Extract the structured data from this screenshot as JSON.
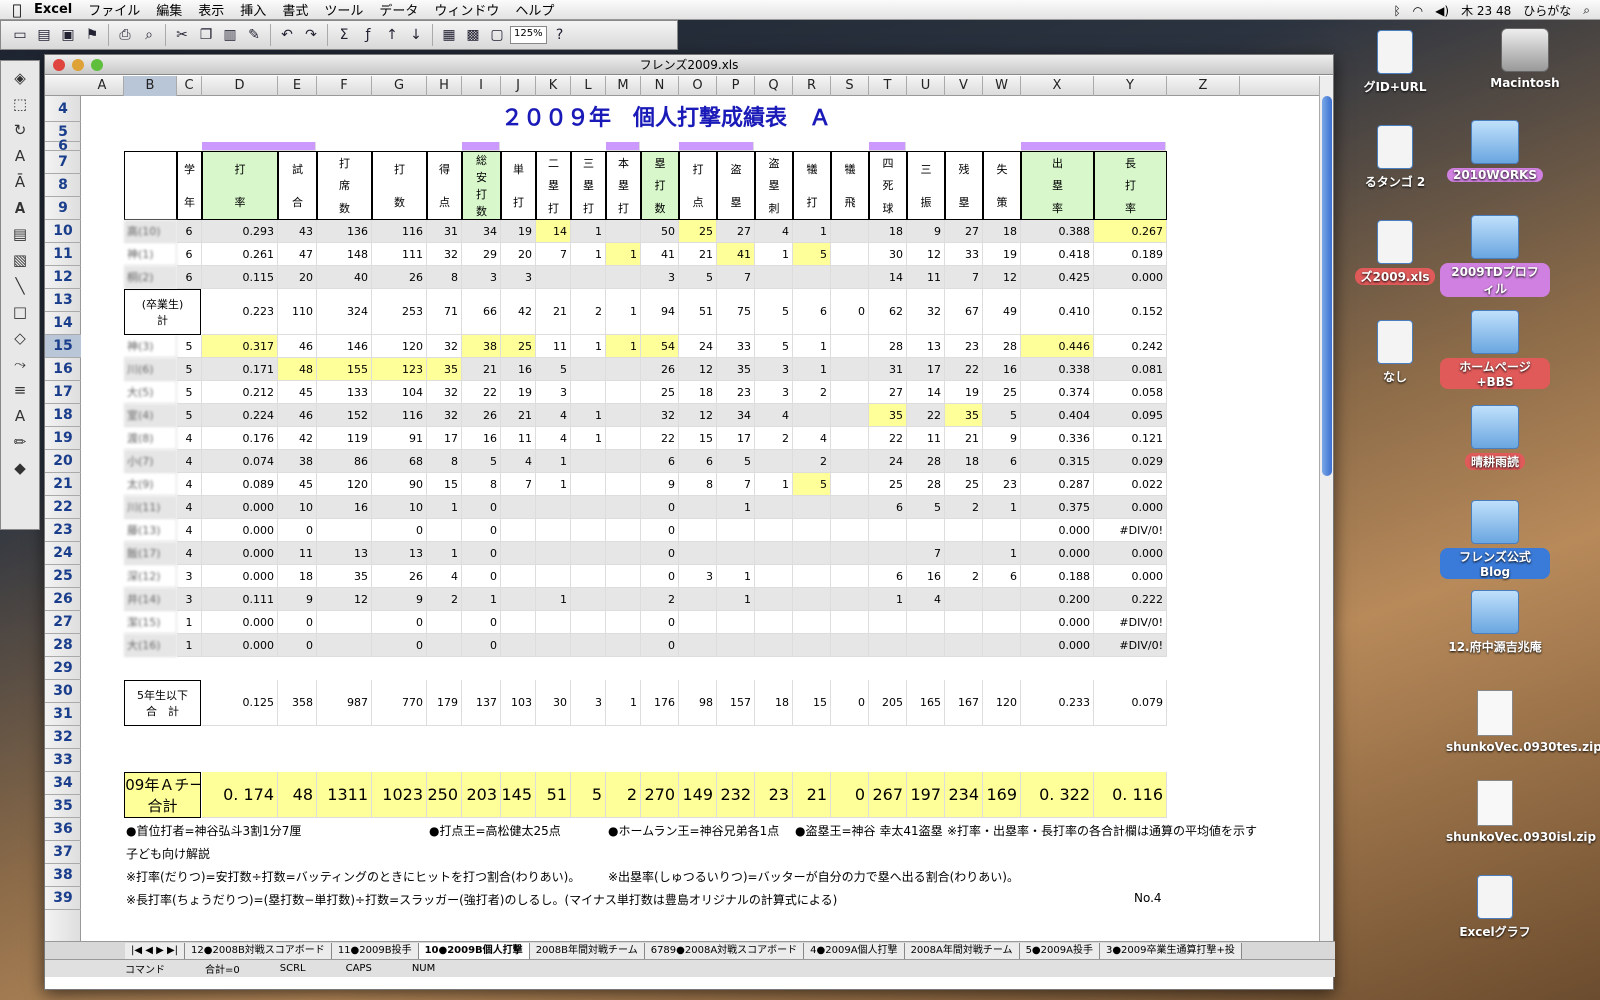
{
  "menubar": {
    "app": "Excel",
    "items": [
      "ファイル",
      "編集",
      "表示",
      "挿入",
      "書式",
      "ツール",
      "データ",
      "ウィンドウ",
      "ヘルプ"
    ],
    "clock": "木 23 48",
    "input": "ひらがな"
  },
  "toolbar": {
    "zoom": "125%"
  },
  "window": {
    "title": "フレンズ2009.xls"
  },
  "columns": [
    "A",
    "B",
    "C",
    "D",
    "E",
    "F",
    "G",
    "H",
    "I",
    "J",
    "K",
    "L",
    "M",
    "N",
    "O",
    "P",
    "Q",
    "R",
    "S",
    "T",
    "U",
    "V",
    "W",
    "X",
    "Y",
    "Z"
  ],
  "sheet": {
    "title": "２００９年　個人打撃成績表　Ａ",
    "headers": {
      "C": [
        "学",
        "年"
      ],
      "D": [
        "打",
        "率"
      ],
      "E": [
        "試",
        "合"
      ],
      "F": [
        "打",
        "席",
        "数"
      ],
      "G": [
        "打",
        "数"
      ],
      "H": [
        "得",
        "点"
      ],
      "I": [
        "総",
        "安",
        "打",
        "数"
      ],
      "J": [
        "単",
        "打"
      ],
      "K": [
        "二",
        "塁",
        "打"
      ],
      "L": [
        "三",
        "塁",
        "打"
      ],
      "M": [
        "本",
        "塁",
        "打"
      ],
      "N": [
        "塁",
        "打",
        "数"
      ],
      "O": [
        "打",
        "点"
      ],
      "P": [
        "盗",
        "塁"
      ],
      "Q": [
        "盗",
        "塁",
        "刺"
      ],
      "R": [
        "犠",
        "打"
      ],
      "S": [
        "犠",
        "飛"
      ],
      "T": [
        "四",
        "死",
        "球"
      ],
      "U": [
        "三",
        "振"
      ],
      "V": [
        "残",
        "塁"
      ],
      "W": [
        "失",
        "策"
      ],
      "X": [
        "出",
        "塁",
        "率"
      ],
      "Y": [
        "長",
        "打",
        "率"
      ]
    },
    "players": [
      {
        "row": "10",
        "name": "高(10)",
        "grade": "6",
        "vals": [
          "0.293",
          "43",
          "136",
          "116",
          "31",
          "34",
          "19",
          "14",
          "1",
          "",
          "50",
          "25",
          "27",
          "4",
          "1",
          "",
          "18",
          "9",
          "27",
          "18",
          "0.388",
          "0.267"
        ]
      },
      {
        "row": "11",
        "name": "神(1)",
        "grade": "6",
        "vals": [
          "0.261",
          "47",
          "148",
          "111",
          "32",
          "29",
          "20",
          "7",
          "1",
          "1",
          "41",
          "21",
          "41",
          "1",
          "5",
          "",
          "30",
          "12",
          "33",
          "19",
          "0.418",
          "0.189"
        ]
      },
      {
        "row": "12",
        "name": "桐(2)",
        "grade": "6",
        "vals": [
          "0.115",
          "20",
          "40",
          "26",
          "8",
          "3",
          "3",
          "",
          "",
          "",
          "3",
          "5",
          "7",
          "",
          "",
          "",
          "14",
          "11",
          "7",
          "12",
          "0.425",
          "0.000"
        ]
      },
      {
        "row": "15",
        "name": "神(3)",
        "grade": "5",
        "vals": [
          "0.317",
          "46",
          "146",
          "120",
          "32",
          "38",
          "25",
          "11",
          "1",
          "1",
          "54",
          "24",
          "33",
          "5",
          "1",
          "",
          "28",
          "13",
          "23",
          "28",
          "0.446",
          "0.242"
        ]
      },
      {
        "row": "16",
        "name": "川(6)",
        "grade": "5",
        "vals": [
          "0.171",
          "48",
          "155",
          "123",
          "35",
          "21",
          "16",
          "5",
          "",
          "",
          "26",
          "12",
          "35",
          "3",
          "1",
          "",
          "31",
          "17",
          "22",
          "16",
          "0.338",
          "0.081"
        ]
      },
      {
        "row": "17",
        "name": "大(5)",
        "grade": "5",
        "vals": [
          "0.212",
          "45",
          "133",
          "104",
          "32",
          "22",
          "19",
          "3",
          "",
          "",
          "25",
          "18",
          "23",
          "3",
          "2",
          "",
          "27",
          "14",
          "19",
          "25",
          "0.374",
          "0.058"
        ]
      },
      {
        "row": "18",
        "name": "室(4)",
        "grade": "5",
        "vals": [
          "0.224",
          "46",
          "152",
          "116",
          "32",
          "26",
          "21",
          "4",
          "1",
          "",
          "32",
          "12",
          "34",
          "4",
          "",
          "",
          "35",
          "22",
          "35",
          "5",
          "0.404",
          "0.095"
        ]
      },
      {
        "row": "19",
        "name": "渡(8)",
        "grade": "4",
        "vals": [
          "0.176",
          "42",
          "119",
          "91",
          "17",
          "16",
          "11",
          "4",
          "1",
          "",
          "22",
          "15",
          "17",
          "2",
          "4",
          "",
          "22",
          "11",
          "21",
          "9",
          "0.336",
          "0.121"
        ]
      },
      {
        "row": "20",
        "name": "小(7)",
        "grade": "4",
        "vals": [
          "0.074",
          "38",
          "86",
          "68",
          "8",
          "5",
          "4",
          "1",
          "",
          "",
          "6",
          "6",
          "5",
          "",
          "2",
          "",
          "24",
          "28",
          "18",
          "6",
          "0.315",
          "0.029"
        ]
      },
      {
        "row": "21",
        "name": "太(9)",
        "grade": "4",
        "vals": [
          "0.089",
          "45",
          "120",
          "90",
          "15",
          "8",
          "7",
          "1",
          "",
          "",
          "9",
          "8",
          "7",
          "1",
          "5",
          "",
          "25",
          "28",
          "25",
          "23",
          "0.287",
          "0.022"
        ]
      },
      {
        "row": "22",
        "name": "川(11)",
        "grade": "4",
        "vals": [
          "0.000",
          "10",
          "16",
          "10",
          "1",
          "0",
          "",
          "",
          "",
          "",
          "0",
          "",
          "1",
          "",
          "",
          "",
          "6",
          "5",
          "2",
          "1",
          "0.375",
          "0.000"
        ]
      },
      {
        "row": "23",
        "name": "藤(13)",
        "grade": "4",
        "vals": [
          "0.000",
          "0",
          "",
          "0",
          "",
          "0",
          "",
          "",
          "",
          "",
          "0",
          "",
          "",
          "",
          "",
          "",
          "",
          "",
          "",
          "",
          "0.000",
          "#DIV/0!"
        ]
      },
      {
        "row": "24",
        "name": "飯(17)",
        "grade": "4",
        "vals": [
          "0.000",
          "11",
          "13",
          "13",
          "1",
          "0",
          "",
          "",
          "",
          "",
          "0",
          "",
          "",
          "",
          "",
          "",
          "",
          "7",
          "",
          "1",
          "0.000",
          "0.000"
        ]
      },
      {
        "row": "25",
        "name": "深(12)",
        "grade": "3",
        "vals": [
          "0.000",
          "18",
          "35",
          "26",
          "4",
          "0",
          "",
          "",
          "",
          "",
          "0",
          "3",
          "1",
          "",
          "",
          "",
          "6",
          "16",
          "2",
          "6",
          "0.188",
          "0.000"
        ]
      },
      {
        "row": "26",
        "name": "井(14)",
        "grade": "3",
        "vals": [
          "0.111",
          "9",
          "12",
          "9",
          "2",
          "1",
          "",
          "1",
          "",
          "",
          "2",
          "",
          "1",
          "",
          "",
          "",
          "1",
          "4",
          "",
          "",
          "0.200",
          "0.222"
        ]
      },
      {
        "row": "27",
        "name": "潔(15)",
        "grade": "1",
        "vals": [
          "0.000",
          "0",
          "",
          "0",
          "",
          "0",
          "",
          "",
          "",
          "",
          "0",
          "",
          "",
          "",
          "",
          "",
          "",
          "",
          "",
          "",
          "0.000",
          "#DIV/0!"
        ]
      },
      {
        "row": "28",
        "name": "大(16)",
        "grade": "1",
        "vals": [
          "0.000",
          "0",
          "",
          "0",
          "",
          "0",
          "",
          "",
          "",
          "",
          "0",
          "",
          "",
          "",
          "",
          "",
          "",
          "",
          "",
          "",
          "0.000",
          "#DIV/0!"
        ]
      }
    ],
    "graduates": {
      "label1": "(卒業生)",
      "label2": "計",
      "vals": [
        "0.223",
        "110",
        "324",
        "253",
        "71",
        "66",
        "42",
        "21",
        "2",
        "1",
        "94",
        "51",
        "75",
        "5",
        "6",
        "0",
        "62",
        "32",
        "67",
        "49",
        "0.410",
        "0.152"
      ]
    },
    "sub5": {
      "label1": "5年生以下",
      "label2": "合　計",
      "vals": [
        "0.125",
        "358",
        "987",
        "770",
        "179",
        "137",
        "103",
        "30",
        "3",
        "1",
        "176",
        "98",
        "157",
        "18",
        "15",
        "0",
        "205",
        "165",
        "167",
        "120",
        "0.233",
        "0.079"
      ]
    },
    "team": {
      "label1": "2009年Ａチーム",
      "label2": "合計",
      "vals": [
        "0. 174",
        "48",
        "1311",
        "1023",
        "250",
        "203",
        "145",
        "51",
        "5",
        "2",
        "270",
        "149",
        "232",
        "23",
        "21",
        "0",
        "267",
        "197",
        "234",
        "169",
        "0. 322",
        "0. 116"
      ]
    },
    "row36": [
      "●首位打者=神谷弘斗3割1分7厘",
      "●打点王=高松健太25点",
      "●ホームラン王=神谷兄弟各1点",
      "●盗塁王=神谷 幸太41盗塁",
      "※打率・出塁率・長打率の各合計欄は通算の平均値を示す"
    ],
    "row37": "子ども向け解説",
    "row38a": "※打率(だりつ)=安打数÷打数=バッティングのときにヒットを打つ割合(わりあい)。",
    "row38b": "※出塁率(しゅつるいりつ)=バッターが自分の力で塁へ出る割合(わりあい)。",
    "row39": "※長打率(ちょうだりつ)=(塁打数−単打数)÷打数=スラッガー(強打者)のしるし。(マイナス単打数は豊島オリジナルの計算式による)",
    "row39no": "No.4"
  },
  "tabs": [
    "12●2008B対戦スコアボード",
    "11●2009B投手",
    "10●2009B個人打撃",
    "2008B年間対戦チーム",
    "6789●2008A対戦スコアボード",
    "4●2009A個人打撃",
    "2008A年間対戦チーム",
    "5●2009A投手",
    "3●2009卒業生通算打撃+投"
  ],
  "status": {
    "mode": "コマンド",
    "sum": "合計=0",
    "scrl": "SCRL",
    "caps": "CAPS",
    "num": "NUM"
  },
  "desktop": [
    {
      "label": "グID+URL",
      "kind": "doc",
      "tag": ""
    },
    {
      "label": "Macintosh",
      "kind": "drive",
      "tag": ""
    },
    {
      "label": "るタンゴ 2",
      "kind": "doc",
      "tag": ""
    },
    {
      "label": "2010WORKS",
      "kind": "folder",
      "tag": "pink"
    },
    {
      "label": "ズ2009.xls",
      "kind": "doc",
      "tag": "red"
    },
    {
      "label": "2009TDプロフィル",
      "kind": "folder",
      "tag": "pink"
    },
    {
      "label": "なし",
      "kind": "doc",
      "tag": ""
    },
    {
      "label": "ホームページ+BBS",
      "kind": "folder",
      "tag": "red"
    },
    {
      "label": "晴耕雨読",
      "kind": "folder",
      "tag": "red"
    },
    {
      "label": "フレンズ公式Blog",
      "kind": "folder",
      "tag": "blue"
    },
    {
      "label": "12.府中源吉兆庵",
      "kind": "folder",
      "tag": ""
    },
    {
      "label": "shunkoVec.0930tes.zip",
      "kind": "zip",
      "tag": ""
    },
    {
      "label": "shunkoVec.0930isl.zip",
      "kind": "zip",
      "tag": ""
    },
    {
      "label": "Excelグラフ",
      "kind": "doc",
      "tag": ""
    }
  ]
}
